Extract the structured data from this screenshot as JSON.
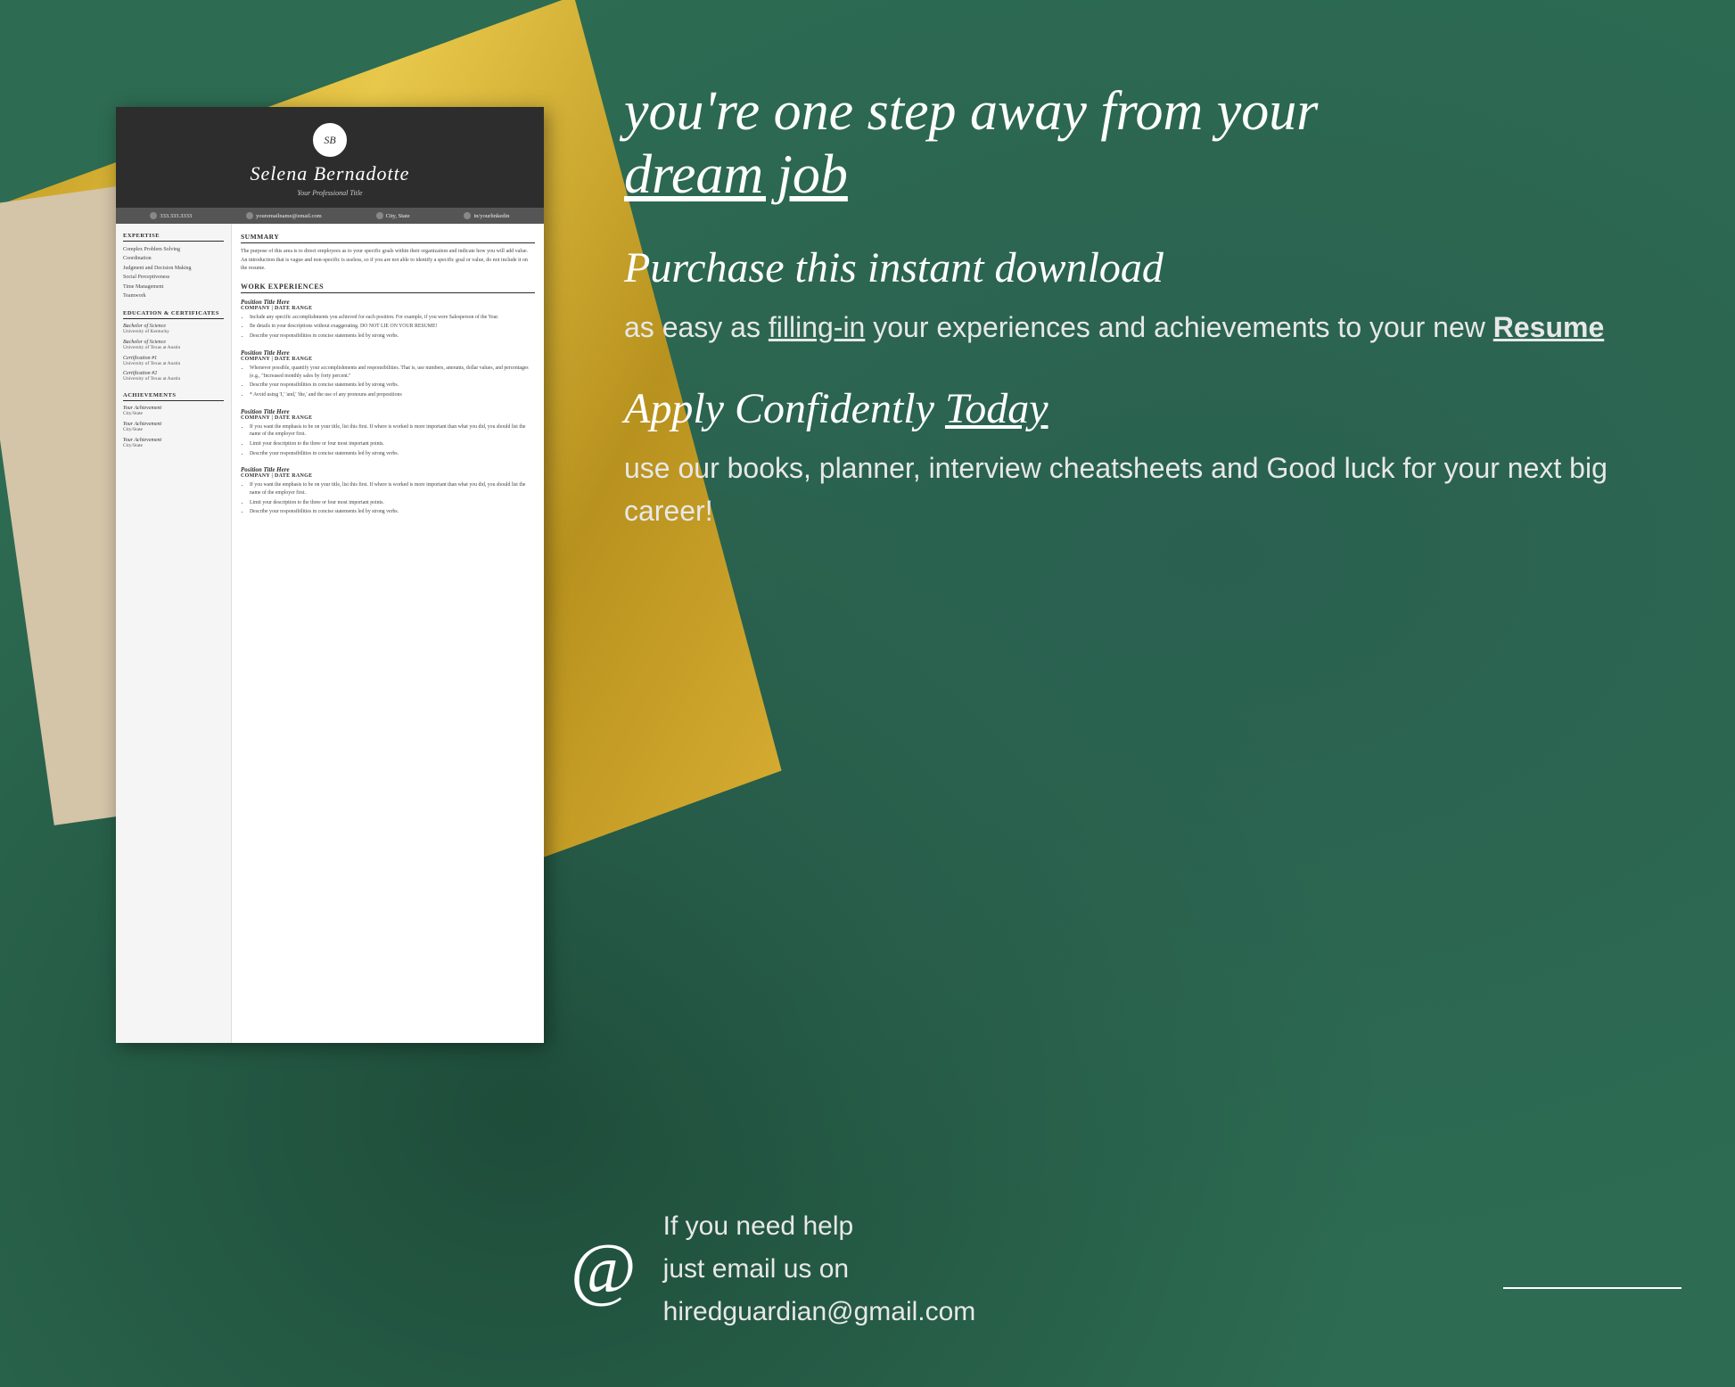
{
  "background": {
    "color": "#2d6b52"
  },
  "tagline": {
    "line1": "you're one step away from your",
    "line2": "dream job"
  },
  "purchase": {
    "title": "Purchase this instant download",
    "body_prefix": "as easy as ",
    "body_link": "filling-in",
    "body_middle": " your experiences and achievements to your new ",
    "body_bold": "Resume"
  },
  "apply": {
    "title_prefix": "Apply Confidently ",
    "title_link": "Today",
    "body": "use our books, planner, interview cheatsheets and Good luck for your next big career!"
  },
  "email_section": {
    "line1": "If you need help",
    "line2": "just email us on",
    "line3": "hiredguardian@gmail.com"
  },
  "resume": {
    "monogram": "SB",
    "name": "Selena Bernadotte",
    "title": "Your Professional Title",
    "contact": {
      "phone": "333.333.3333",
      "email": "youremailname@email.com",
      "location": "City, State",
      "linkedin": "in/yourlinkedin"
    },
    "expertise": {
      "section": "EXPERTISE",
      "skills": [
        "Complex Problem Solving",
        "Coordination",
        "Judgment and Decision Making",
        "Social Perceptiveness",
        "Time Management",
        "Teamwork"
      ]
    },
    "education": {
      "section": "EDUCATION & CERTIFICATES",
      "degrees": [
        {
          "degree": "Bachelor of Science",
          "school": "University of Kentucky"
        },
        {
          "degree": "Bachelor of Science",
          "school": "University of Texas at Austin"
        }
      ],
      "certs": [
        {
          "name": "Certification #1",
          "school": "University of Texas at Austin"
        },
        {
          "name": "Certification #2",
          "school": "University of Texas at Austin"
        }
      ]
    },
    "achievements": {
      "section": "ACHIEVEMENTS",
      "items": [
        {
          "name": "Your Achievement",
          "location": "City/State"
        },
        {
          "name": "Your Achievement",
          "location": "City/State"
        },
        {
          "name": "Your Achievement",
          "location": "City/State"
        }
      ]
    },
    "summary": {
      "title": "SUMMARY",
      "text": "The purpose of this area is to direct employees as to your specific goals within their organization and indicate how you will add value. An introduction that is vague and non-specific is useless, so if you are not able to identify a specific goal or value, do not include it on the resume."
    },
    "work_experiences": {
      "title": "WORK EXPERIENCES",
      "jobs": [
        {
          "title": "Position Title Here",
          "company": "COMPANY | DATE RANGE",
          "bullets": [
            "Include any specific accomplishments you achieved for each position. For example, if you were Salesperson of the Year.",
            "Be details in your descriptions without exaggerating. DO NOT LIE ON YOUR RESUME!",
            "Describe your responsibilities in concise statements led by strong verbs."
          ]
        },
        {
          "title": "Position Title Here",
          "company": "COMPANY | DATE RANGE",
          "bullets": [
            "Whenever possible, quantify your accomplishments and responsibilities. That is, use numbers, amounts, dollar values, and percentages (e.g., \"Increased monthly sales by forty percent.\"",
            "Describe your responsibilities in concise statements led by strong verbs.",
            "* Avoid using 'I,' 'and,' 'the,' and the use of any pronouns and prepositions"
          ]
        },
        {
          "title": "Position Title Here",
          "company": "COMPANY | DATE RANGE",
          "bullets": [
            "If you want the emphasis to be on your title, list this first. If where is worked is more important than what you did, you should list the name of the employer first.",
            "Limit your description to the three or four most important points.",
            "Describe your responsibilities in concise statements led by strong verbs."
          ]
        },
        {
          "title": "Position Title Here",
          "company": "COMPANY | DATE RANGE",
          "bullets": [
            "If you want the emphasis to be on your title, list this first. If where is worked is more important than what you did, you should list the name of the employer first.",
            "Limit your description to the three or four most important points.",
            "Describe your responsibilities in concise statements led by strong verbs."
          ]
        }
      ]
    }
  }
}
